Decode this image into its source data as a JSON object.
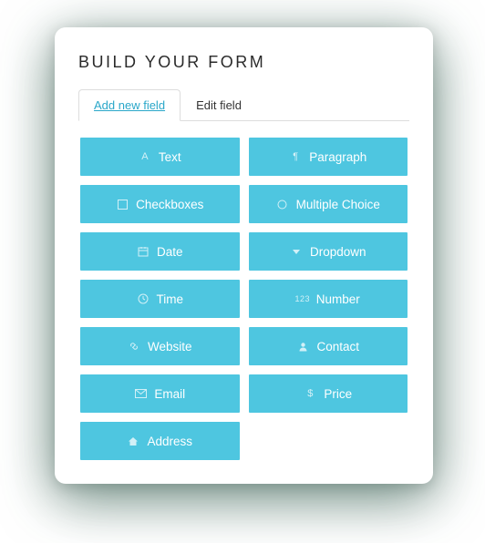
{
  "title": "BUILD YOUR FORM",
  "tabs": {
    "add": "Add new field",
    "edit": "Edit field"
  },
  "fields": {
    "text": {
      "label": "Text",
      "icon": "font-icon"
    },
    "paragraph": {
      "label": "Paragraph",
      "icon": "paragraph-icon"
    },
    "checkboxes": {
      "label": "Checkboxes",
      "icon": "checkbox-icon"
    },
    "multiple": {
      "label": "Multiple Choice",
      "icon": "radio-icon"
    },
    "date": {
      "label": "Date",
      "icon": "calendar-icon"
    },
    "dropdown": {
      "label": "Dropdown",
      "icon": "caret-down-icon"
    },
    "time": {
      "label": "Time",
      "icon": "clock-icon"
    },
    "number": {
      "label": "Number",
      "icon": "number-icon"
    },
    "website": {
      "label": "Website",
      "icon": "link-icon"
    },
    "contact": {
      "label": "Contact",
      "icon": "user-icon"
    },
    "email": {
      "label": "Email",
      "icon": "envelope-icon"
    },
    "price": {
      "label": "Price",
      "icon": "dollar-icon"
    },
    "address": {
      "label": "Address",
      "icon": "home-icon"
    }
  },
  "colors": {
    "accent": "#4ec6e0",
    "tabActive": "#2aa7c9"
  }
}
